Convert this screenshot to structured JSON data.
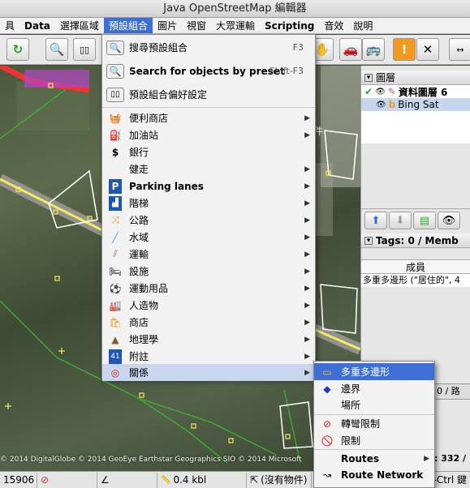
{
  "window": {
    "title": "Java OpenStreetMap 編輯器"
  },
  "menubar": [
    {
      "label": "具",
      "active": false
    },
    {
      "label": "Data",
      "active": false
    },
    {
      "label": "選擇區域",
      "active": false
    },
    {
      "label": "預設組合",
      "active": true
    },
    {
      "label": "圖片",
      "active": false
    },
    {
      "label": "視窗",
      "active": false
    },
    {
      "label": "大眾運輸",
      "active": false
    },
    {
      "label": "Scripting",
      "active": false
    },
    {
      "label": "音效",
      "active": false
    },
    {
      "label": "說明",
      "active": false
    }
  ],
  "presets_menu": {
    "top_items": [
      {
        "label": "搜尋預設組合",
        "shortcut": "F3",
        "icon": "search-preset-icon"
      },
      {
        "label": "Search for objects by preset",
        "shortcut": "Shift-F3",
        "icon": "search-objects-icon"
      },
      {
        "label": "預設組合偏好設定",
        "shortcut": "",
        "icon": "preferences-icon"
      }
    ],
    "items": [
      {
        "label": "便利商店",
        "icon": "basket-icon",
        "bold": false
      },
      {
        "label": "加油站",
        "icon": "fuel-icon",
        "bold": false
      },
      {
        "label": "銀行",
        "icon": "bank-icon",
        "bold": false
      },
      {
        "label": "健走",
        "icon": "",
        "bold": false
      },
      {
        "label": "Parking lanes",
        "icon": "parking-icon",
        "bold": true
      },
      {
        "label": "階梯",
        "icon": "stairs-icon",
        "bold": false
      },
      {
        "label": "公路",
        "icon": "road-icon",
        "bold": false
      },
      {
        "label": "水域",
        "icon": "water-icon",
        "bold": false
      },
      {
        "label": "運輸",
        "icon": "railway-icon",
        "bold": false
      },
      {
        "label": "設施",
        "icon": "bed-icon",
        "bold": false
      },
      {
        "label": "運動用品",
        "icon": "ball-icon",
        "bold": false
      },
      {
        "label": "人造物",
        "icon": "factory-icon",
        "bold": false
      },
      {
        "label": "商店",
        "icon": "shopping-bag-icon",
        "bold": false
      },
      {
        "label": "地理學",
        "icon": "mountain-icon",
        "bold": false
      },
      {
        "label": "附註",
        "icon": "note-icon",
        "bold": false
      },
      {
        "label": "關係",
        "icon": "relation-icon",
        "bold": false
      }
    ]
  },
  "relations_submenu": {
    "items": [
      {
        "label": "多重多邊形",
        "icon": "multipolygon-icon",
        "bold": false,
        "highlighted": true
      },
      {
        "label": "邊界",
        "icon": "boundary-icon",
        "bold": false,
        "highlighted": false
      },
      {
        "label": "場所",
        "icon": "",
        "bold": false,
        "highlighted": false
      },
      {
        "label": "轉彎限制",
        "icon": "no-turn-icon",
        "bold": false,
        "highlighted": false
      },
      {
        "label": "限制",
        "icon": "restriction-icon",
        "bold": false,
        "highlighted": false
      },
      {
        "label": "Routes",
        "icon": "",
        "bold": true,
        "highlighted": false
      },
      {
        "label": "Route Network",
        "icon": "route-icon",
        "bold": true,
        "highlighted": false
      }
    ]
  },
  "layers_panel": {
    "title": "圖層",
    "layers": [
      {
        "name": "資料圖層 6",
        "selected": false
      },
      {
        "name": "Bing Sat",
        "selected": true
      }
    ]
  },
  "tags_panel": {
    "title": "Tags: 0 / Memb",
    "column_header": "成員",
    "row": "多重多邊形 (\"居住的\", 4"
  },
  "map": {
    "label_fragment": "件",
    "attribution": "© 2014 DigitalGlobe © 2014 GeoEye Earthstar Geographics  SIO © 2014 Microsoft"
  },
  "statusbar": {
    "coord": "15906",
    "length": "0.4 kbl",
    "selection": "(沒有物件)"
  },
  "right_fragments": {
    "tab_text": "0 / 路",
    "count_text": ": 332 /",
    "shortcut_text": "t-Ctrl 鍵"
  },
  "colors": {
    "accent": "#3d6fd6",
    "relation_icon": "#cc2222"
  }
}
